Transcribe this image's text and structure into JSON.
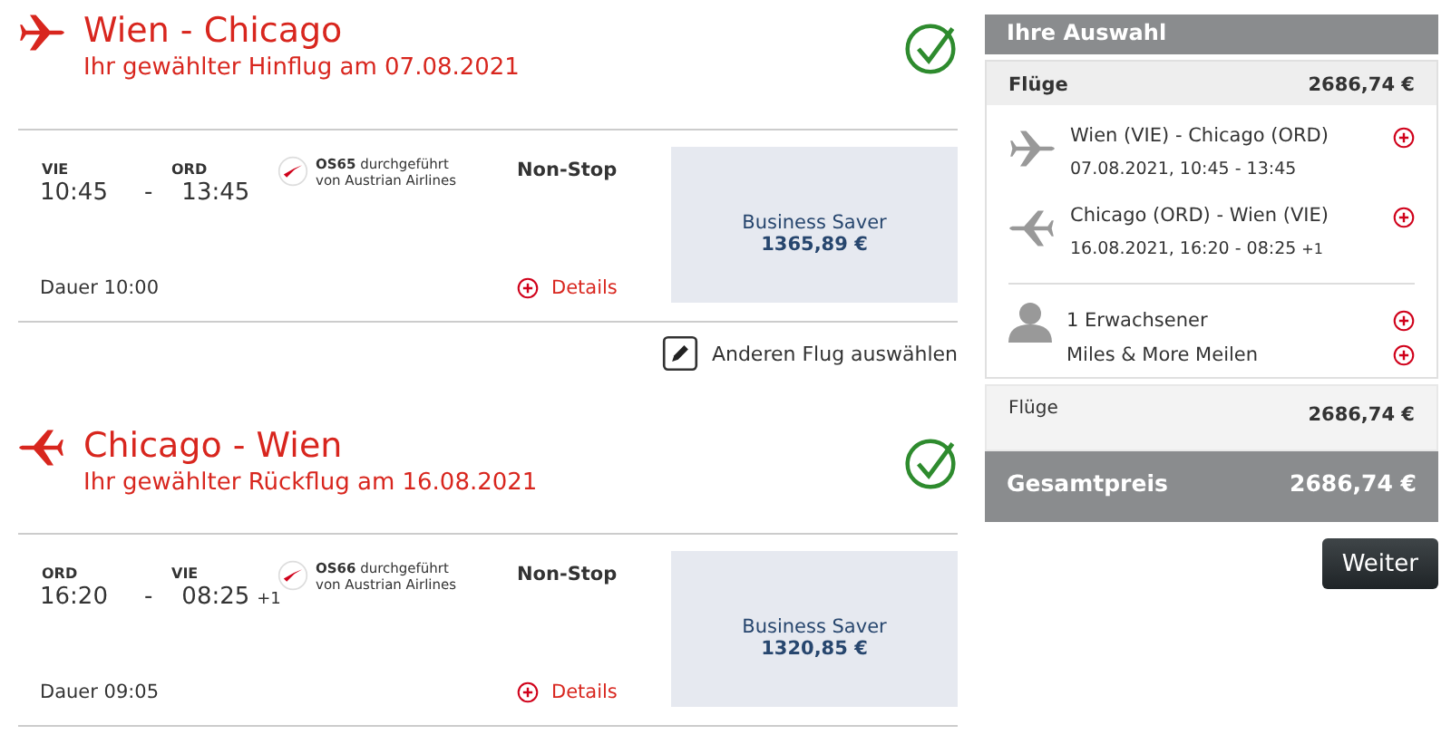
{
  "flights": [
    {
      "kind": "outbound",
      "title": "Wien - Chicago",
      "subtitle": "Ihr gewählter Hinflug am 07.08.2021",
      "confirmed": true,
      "from_code": "VIE",
      "to_code": "ORD",
      "departure": "10:45",
      "separator": "-",
      "arrival": "13:45",
      "flight_no": "OS65",
      "operated": "durchgeführt",
      "operator": "von Austrian Airlines",
      "stops": "Non-Stop",
      "duration": "Dauer 10:00",
      "details": "Details",
      "fare": "Business Saver",
      "price": "1365,89 €",
      "change_link": "Anderen Flug auswählen"
    },
    {
      "kind": "return",
      "title": "Chicago - Wien",
      "subtitle": "Ihr gewählter Rückflug am 16.08.2021",
      "confirmed": true,
      "from_code": "ORD",
      "to_code": "VIE",
      "departure": "16:20",
      "separator": "-",
      "arrival": "08:25",
      "arrival_suffix": "+1",
      "flight_no": "OS66",
      "operated": "durchgeführt",
      "operator": "von Austrian Airlines",
      "stops": "Non-Stop",
      "duration": "Dauer 09:05",
      "details": "Details",
      "fare": "Business Saver",
      "price": "1320,85 €"
    }
  ],
  "summary": {
    "title": "Ihre Auswahl",
    "flights_label": "Flüge",
    "flights_amount": "2686,74 €",
    "legs": [
      {
        "kind": "outbound",
        "route": "Wien (VIE) - Chicago (ORD)",
        "times": "07.08.2021, 10:45 - 13:45"
      },
      {
        "kind": "return",
        "route": "Chicago (ORD) - Wien (VIE)",
        "times": "16.08.2021, 16:20 - 08:25",
        "suffix": "+1"
      }
    ],
    "passengers": "1 Erwachsener",
    "miles": "Miles & More Meilen",
    "subtotal_label": "Flüge",
    "subtotal_amount": "2686,74 €",
    "total_label": "Gesamtpreis",
    "total_amount": "2686,74 €",
    "button": "Weiter"
  }
}
